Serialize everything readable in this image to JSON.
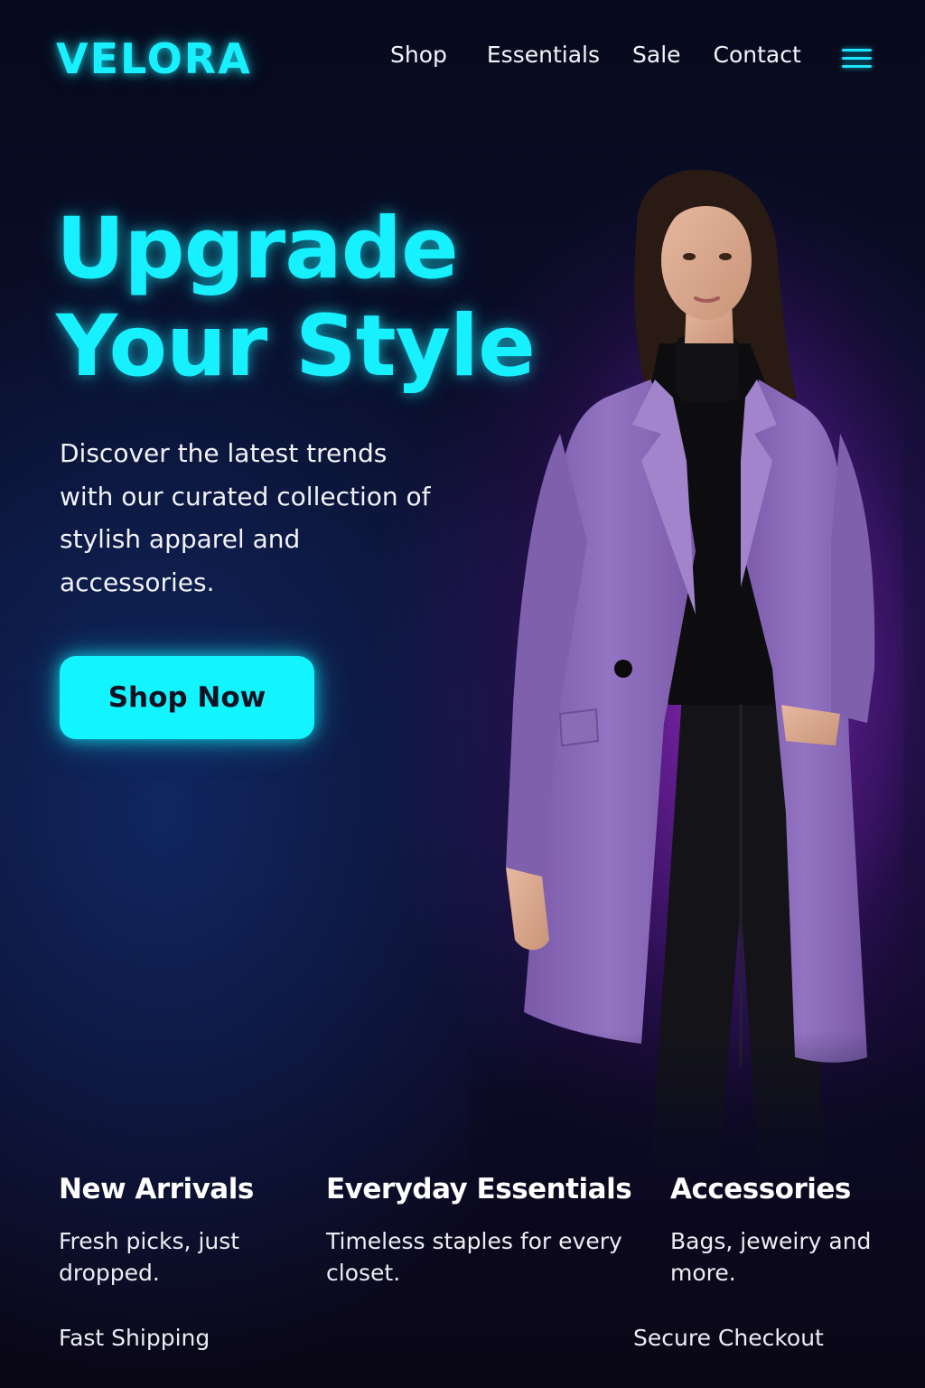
{
  "brand": {
    "logo": "VELORA"
  },
  "nav": {
    "items": [
      {
        "label": "Shop"
      },
      {
        "label": "Essentials"
      },
      {
        "label": "Sale"
      },
      {
        "label": "Contact"
      }
    ],
    "menu_icon": "hamburger-menu-icon"
  },
  "hero": {
    "headline_line1": "Upgrade",
    "headline_line2": "Your Style",
    "subtext": "Discover the latest trends with our curated collection of stylish apparel and accessories.",
    "cta_label": "Shop Now",
    "image": "model-in-purple-coat"
  },
  "features": [
    {
      "title": "New Arrivals",
      "description": "Fresh picks, just dropped."
    },
    {
      "title": "Everyday Essentials",
      "description": "Timeless staples for every closet."
    },
    {
      "title": "Accessories",
      "description": "Bags, jeweiry and more."
    }
  ],
  "badges": {
    "shipping": "Fast Shipping",
    "checkout": "Secure Checkout"
  },
  "colors": {
    "accent": "#17f0ff",
    "background": "#070a1c",
    "glow_purple": "#a828d2",
    "coat": "#8c6bb8"
  }
}
